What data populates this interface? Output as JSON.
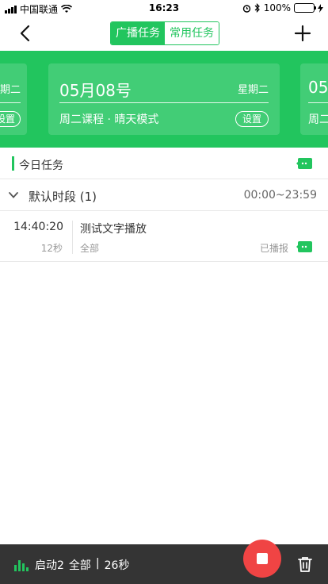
{
  "status_bar": {
    "carrier": "中国联通",
    "time": "16:23",
    "battery": "100%"
  },
  "nav": {
    "tabs": [
      {
        "label": "广播任务",
        "active": true
      },
      {
        "label": "常用任务",
        "active": false
      }
    ]
  },
  "carousel": {
    "prev_card": {
      "week": "星期二",
      "action": "设置"
    },
    "main_card": {
      "date": "05月08号",
      "week": "星期二",
      "description": "周二课程 · 晴天模式",
      "action": "设置"
    },
    "next_card": {
      "date": "05",
      "description": "周二"
    }
  },
  "today": {
    "title": "今日任务"
  },
  "group": {
    "name": "默认时段 (1)",
    "time_range": "00:00~23:59"
  },
  "tasks": [
    {
      "time": "14:40:20",
      "duration": "12秒",
      "name": "测试文字播放",
      "scope": "全部",
      "status": "已播报"
    }
  ],
  "bottom_bar": {
    "status_label": "启动2",
    "scope": "全部",
    "separator": "|",
    "duration": "26秒"
  },
  "colors": {
    "accent": "#22c55e",
    "stop": "#f04444",
    "bottom_bar": "#343434"
  },
  "icons": [
    "back-icon",
    "plus-icon",
    "message-icon",
    "chevron-down-icon",
    "sound-bars-icon",
    "stop-icon",
    "trash-icon",
    "wifi-icon",
    "bluetooth-icon",
    "alarm-icon",
    "charging-icon"
  ]
}
